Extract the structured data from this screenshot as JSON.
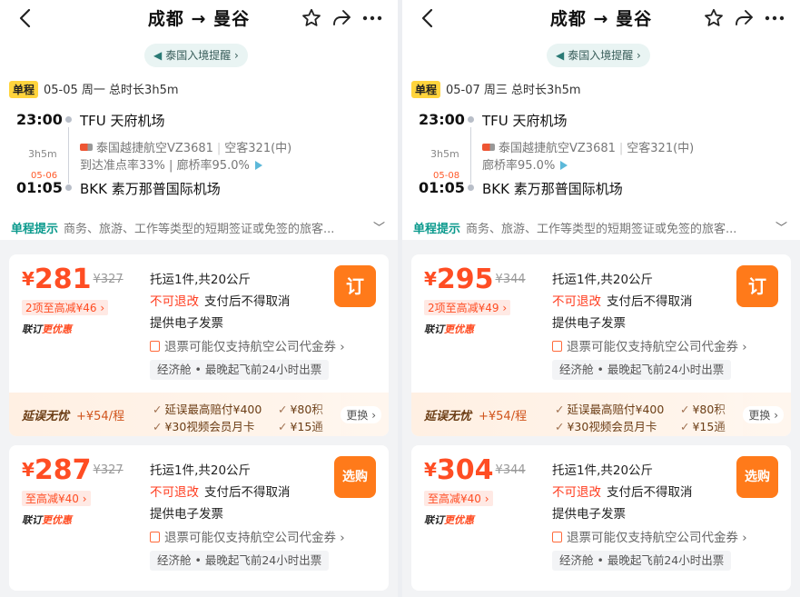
{
  "panels": [
    {
      "title": "成都 → 曼谷",
      "notice": "泰国入境提醒 ›",
      "trip_tag": "单程",
      "trip_info": "05-05 周一 总时长3h5m",
      "dep_time": "23:00",
      "dep_airport": "TFU 天府机场",
      "duration": "3h5m",
      "next_day": "05-06",
      "arr_time": "01:05",
      "arr_airport": "BKK 素万那普国际机场",
      "airline": "泰国越捷航空VZ3681",
      "aircraft": "空客321(中)",
      "stats": "到达准点率33% | 廊桥率95.0%",
      "tip_label": "单程提示",
      "tip_text": "商务、旅游、工作等类型的短期签证或免签的旅客...",
      "card1": {
        "currency": "¥",
        "price": "281",
        "old_price": "¥327",
        "save": "2项至高减¥46 ›",
        "combo_a": "联订",
        "combo_b": "更优惠",
        "baggage": "托运1件,共20公斤",
        "no_refund": "不可退改",
        "no_cancel": "支付后不得取消",
        "invoice": "提供电子发票",
        "refund": "退票可能仅支持航空公司代金券 ›",
        "cabin": "经济舱 • 最晚起飞前24小时出票",
        "button": "订",
        "insure_name": "延误无忧",
        "insure_price": "+¥54/程",
        "insure_items": [
          "延误最高赔付¥400",
          "¥80积",
          "¥30视频会员月卡",
          "¥15通"
        ],
        "change": "更换 ›"
      },
      "card2": {
        "currency": "¥",
        "price": "287",
        "old_price": "¥327",
        "save": "至高减¥40 ›",
        "combo_a": "联订",
        "combo_b": "更优惠",
        "baggage": "托运1件,共20公斤",
        "no_refund": "不可退改",
        "no_cancel": "支付后不得取消",
        "invoice": "提供电子发票",
        "refund": "退票可能仅支持航空公司代金券 ›",
        "cabin": "经济舱 • 最晚起飞前24小时出票",
        "button": "选购"
      }
    },
    {
      "title": "成都 → 曼谷",
      "notice": "泰国入境提醒 ›",
      "trip_tag": "单程",
      "trip_info": "05-07 周三 总时长3h5m",
      "dep_time": "23:00",
      "dep_airport": "TFU 天府机场",
      "duration": "3h5m",
      "next_day": "05-08",
      "arr_time": "01:05",
      "arr_airport": "BKK 素万那普国际机场",
      "airline": "泰国越捷航空VZ3681",
      "aircraft": "空客321(中)",
      "stats": "廊桥率95.0%",
      "tip_label": "单程提示",
      "tip_text": "商务、旅游、工作等类型的短期签证或免签的旅客...",
      "card1": {
        "currency": "¥",
        "price": "295",
        "old_price": "¥344",
        "save": "2项至高减¥49 ›",
        "combo_a": "联订",
        "combo_b": "更优惠",
        "baggage": "托运1件,共20公斤",
        "no_refund": "不可退改",
        "no_cancel": "支付后不得取消",
        "invoice": "提供电子发票",
        "refund": "退票可能仅支持航空公司代金券 ›",
        "cabin": "经济舱 • 最晚起飞前24小时出票",
        "button": "订",
        "insure_name": "延误无忧",
        "insure_price": "+¥54/程",
        "insure_items": [
          "延误最高赔付¥400",
          "¥80积",
          "¥30视频会员月卡",
          "¥15通"
        ],
        "change": "更换 ›"
      },
      "card2": {
        "currency": "¥",
        "price": "304",
        "old_price": "¥344",
        "save": "至高减¥40 ›",
        "combo_a": "联订",
        "combo_b": "更优惠",
        "baggage": "托运1件,共20公斤",
        "no_refund": "不可退改",
        "no_cancel": "支付后不得取消",
        "invoice": "提供电子发票",
        "refund": "退票可能仅支持航空公司代金券 ›",
        "cabin": "经济舱 • 最晚起飞前24小时出票",
        "button": "选购"
      }
    }
  ],
  "colors": {
    "accent": "#ff7a1a",
    "price": "#ff4d23",
    "tip": "#0b9a8d",
    "tag": "#ffd43d"
  }
}
